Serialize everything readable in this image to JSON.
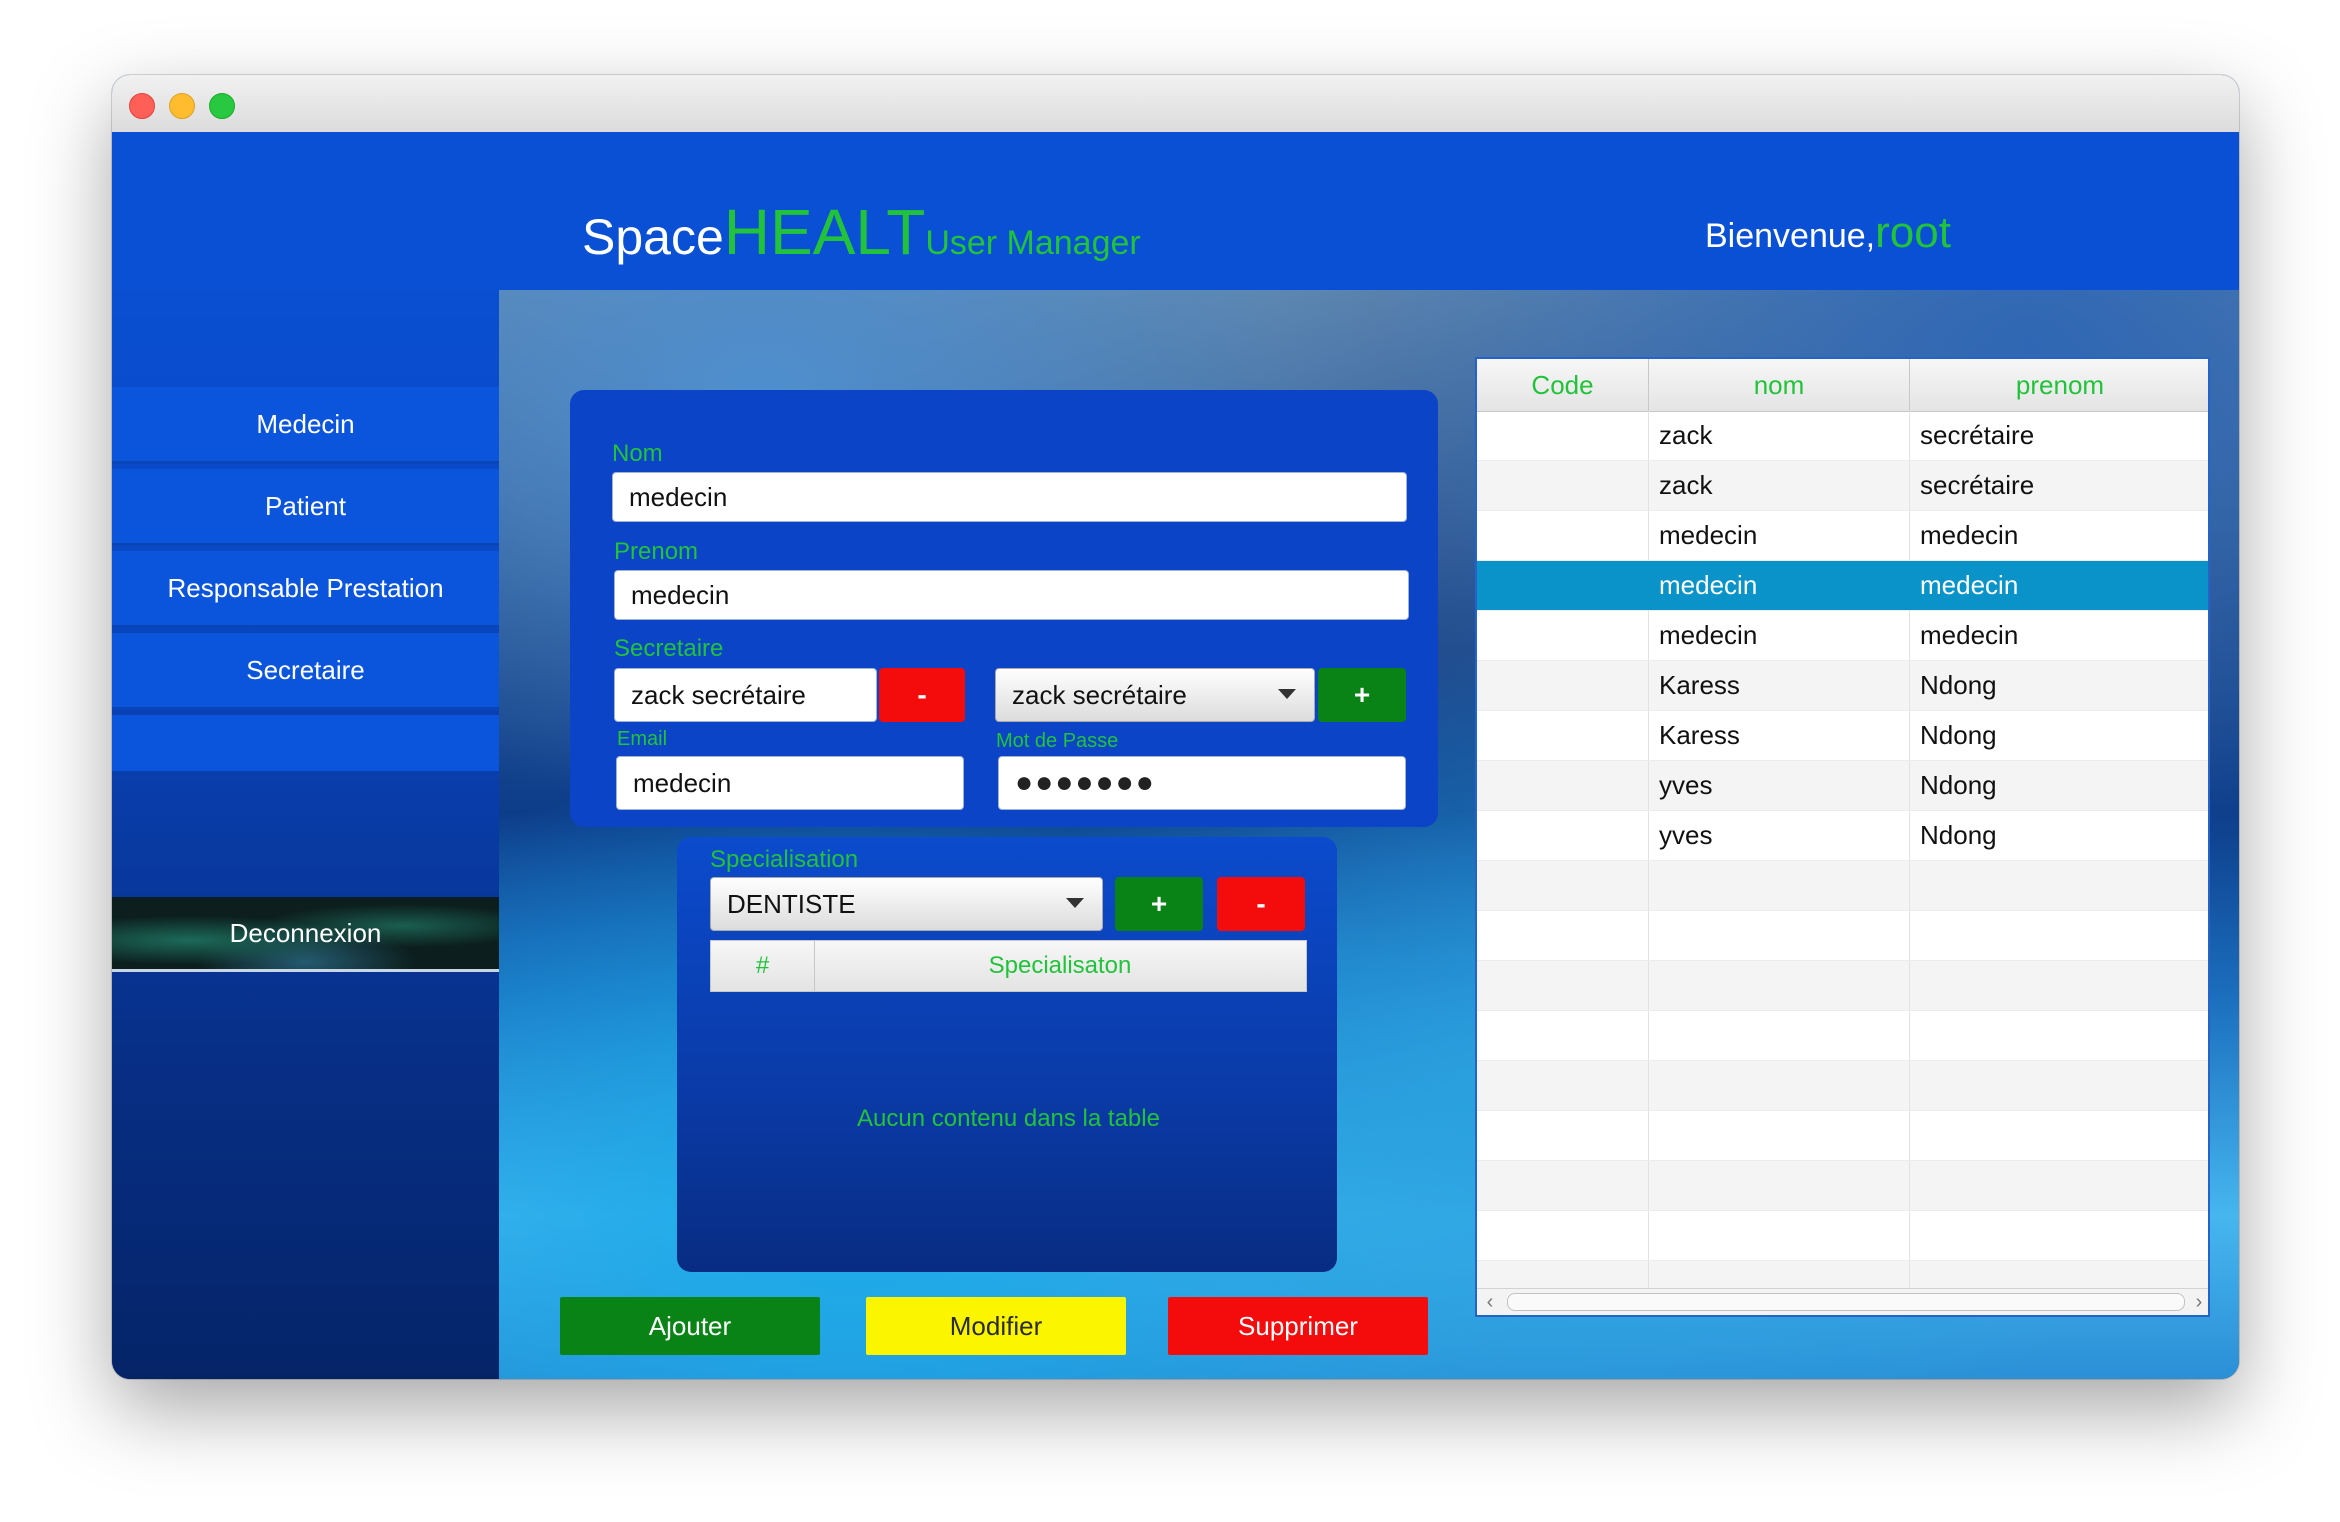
{
  "header": {
    "brand_space": "Space",
    "brand_healt": "HEALT",
    "brand_um": "User Manager",
    "welcome_label": "Bienvenue,",
    "welcome_user": "root"
  },
  "sidebar": {
    "items": [
      {
        "label": "Medecin"
      },
      {
        "label": "Patient"
      },
      {
        "label": "Responsable Prestation"
      },
      {
        "label": "Secretaire"
      }
    ],
    "logout_label": "Deconnexion"
  },
  "form": {
    "nom_label": "Nom",
    "nom_value": "medecin",
    "prenom_label": "Prenom",
    "prenom_value": "medecin",
    "secretaire_label": "Secretaire",
    "secretaire_value": "zack secrétaire",
    "secretaire_remove": "-",
    "secretaire_combo": "zack secrétaire",
    "secretaire_add": "+",
    "email_label": "Email",
    "email_value": "medecin",
    "password_label": "Mot de Passe",
    "password_value": "●●●●●●●"
  },
  "specialisation": {
    "label": "Specialisation",
    "selected": "DENTISTE",
    "add": "+",
    "remove": "-",
    "col_num": "#",
    "col_name": "Specialisaton",
    "empty": "Aucun contenu dans la table"
  },
  "actions": {
    "add": "Ajouter",
    "modify": "Modifier",
    "delete": "Supprimer"
  },
  "table": {
    "columns": [
      "Code",
      "nom",
      "prenom"
    ],
    "rows": [
      {
        "code": "",
        "nom": "zack",
        "prenom": "secrétaire"
      },
      {
        "code": "",
        "nom": "zack",
        "prenom": "secrétaire"
      },
      {
        "code": "",
        "nom": "medecin",
        "prenom": "medecin"
      },
      {
        "code": "",
        "nom": "medecin",
        "prenom": "medecin",
        "selected": true
      },
      {
        "code": "",
        "nom": "medecin",
        "prenom": "medecin"
      },
      {
        "code": "",
        "nom": "Karess",
        "prenom": "Ndong"
      },
      {
        "code": "",
        "nom": "Karess",
        "prenom": "Ndong"
      },
      {
        "code": "",
        "nom": "yves",
        "prenom": "Ndong"
      },
      {
        "code": "",
        "nom": "yves",
        "prenom": "Ndong"
      }
    ],
    "empty_rows": 9
  },
  "colors": {
    "accent_green": "#22c33b",
    "header_blue": "#0a50d4",
    "selection": "#0a93c9"
  }
}
